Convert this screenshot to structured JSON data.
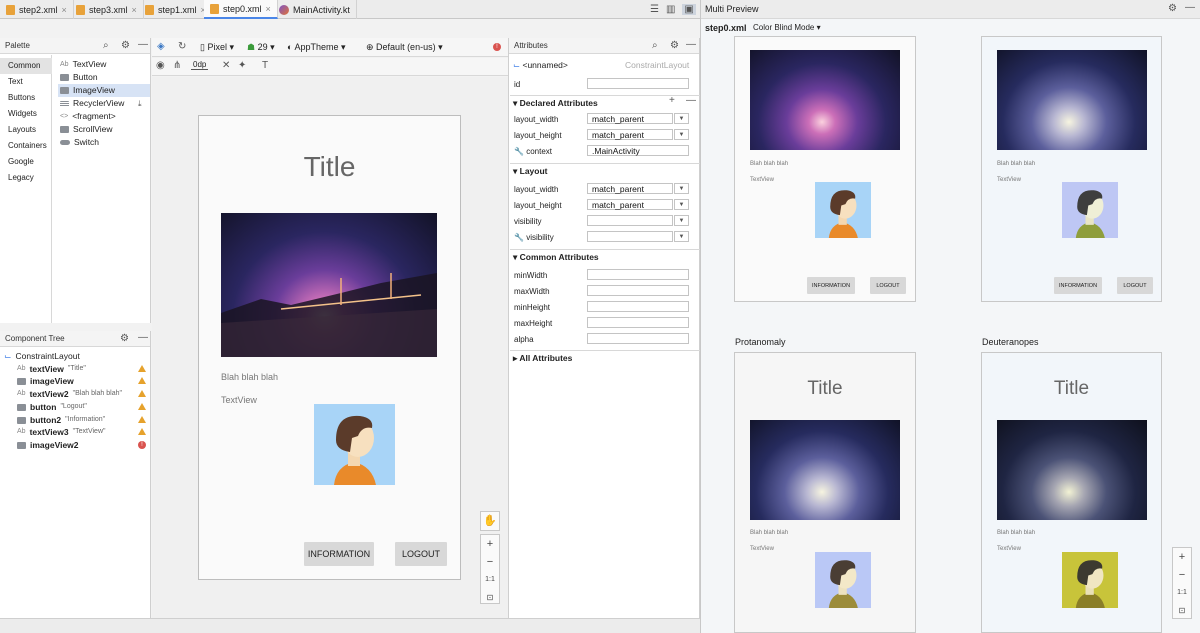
{
  "tabs": [
    {
      "label": "step2.xml",
      "x": "×"
    },
    {
      "label": "step3.xml",
      "x": "×"
    },
    {
      "label": "step1.xml",
      "x": "×"
    },
    {
      "label": "step0.xml",
      "x": "×"
    },
    {
      "label": "MainActivity.kt",
      "x": "×"
    }
  ],
  "palette": {
    "title": "Palette",
    "categories": [
      "Common",
      "Text",
      "Buttons",
      "Widgets",
      "Layouts",
      "Containers",
      "Google",
      "Legacy"
    ],
    "items": [
      {
        "prefix": "Ab",
        "label": "TextView"
      },
      {
        "label": "Button"
      },
      {
        "label": "ImageView"
      },
      {
        "label": "RecyclerView"
      },
      {
        "prefix": "<>",
        "label": "<fragment>"
      },
      {
        "label": "ScrollView"
      },
      {
        "label": "Switch"
      }
    ]
  },
  "tree": {
    "title": "Component Tree",
    "root": "ConstraintLayout",
    "rows": [
      {
        "prefix": "Ab",
        "name": "textView",
        "hint": "\"Title\""
      },
      {
        "name": "imageView",
        "hint": ""
      },
      {
        "prefix": "Ab",
        "name": "textView2",
        "hint": "\"Blah blah blah\""
      },
      {
        "name": "button",
        "hint": "\"Logout\""
      },
      {
        "name": "button2",
        "hint": "\"Information\""
      },
      {
        "prefix": "Ab",
        "name": "textView3",
        "hint": "\"TextView\""
      },
      {
        "name": "imageView2",
        "hint": ""
      }
    ]
  },
  "toolbar": {
    "device": "Pixel",
    "api": "29",
    "theme": "AppTheme",
    "locale": "Default (en-us)",
    "margin": "0dp"
  },
  "phone": {
    "title": "Title",
    "text2": "Blah blah blah",
    "text3": "TextView",
    "btn_info": "INFORMATION",
    "btn_logout": "LOGOUT"
  },
  "zoom": {
    "plus": "+",
    "minus": "−",
    "fit": "1:1"
  },
  "attributes": {
    "title": "Attributes",
    "unnamed": "<unnamed>",
    "type": "ConstraintLayout",
    "id_label": "id",
    "declared": "Declared Attributes",
    "layout_width": "layout_width",
    "layout_height": "layout_height",
    "match_parent": "match_parent",
    "context_label": "context",
    "context_value": ".MainActivity",
    "layout": "Layout",
    "visibility": "visibility",
    "common": "Common Attributes",
    "minWidth": "minWidth",
    "maxWidth": "maxWidth",
    "minHeight": "minHeight",
    "maxHeight": "maxHeight",
    "alpha": "alpha",
    "all": "All Attributes",
    "plus": "+",
    "minus": "—"
  },
  "preview": {
    "title": "Multi Preview",
    "file": "step0.xml",
    "mode": "Color Blind Mode",
    "label_protanomaly": "Protanomaly",
    "label_deuteranopes": "Deuteranopes",
    "title_text": "Title",
    "text2": "Blah blah blah",
    "text3": "TextView",
    "btn_info": "INFORMATION",
    "btn_logout": "LOGOUT"
  },
  "colors": {
    "accent": "#4a86e8",
    "warning": "#e6a22c",
    "error": "#d9534f"
  }
}
